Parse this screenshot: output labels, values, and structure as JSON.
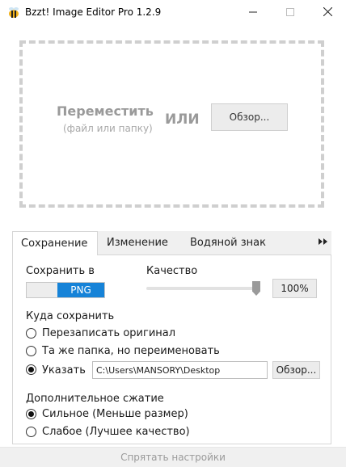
{
  "window": {
    "title": "Bzzt! Image Editor Pro 1.2.9",
    "app_icon": "bee-icon",
    "controls": [
      "minimize-icon",
      "maximize-icon",
      "close-icon"
    ]
  },
  "drop_zone": {
    "title": "Переместить",
    "subtitle": "(файл или папку)",
    "or_label": "ИЛИ",
    "browse_label": "Обзор..."
  },
  "tabs": {
    "items": [
      {
        "label": "Сохранение",
        "active": true
      },
      {
        "label": "Изменение",
        "active": false
      },
      {
        "label": "Водяной знак",
        "active": false
      }
    ],
    "more_icon": "double-chevron-right-icon"
  },
  "save_panel": {
    "save_in_label": "Сохранить в",
    "format_toggle": {
      "selected": "PNG"
    },
    "quality_label": "Качество",
    "quality_value": "100%",
    "quality_level": 1.0,
    "where_label": "Куда сохранить",
    "where_options": [
      {
        "label": "Перезаписать оригинал",
        "checked": false
      },
      {
        "label": "Та же папка, но переименовать",
        "checked": false
      },
      {
        "label": "Указать",
        "checked": true
      }
    ],
    "path_value": "C:\\Users\\MANSORY\\Desktop",
    "path_browse_label": "Обзор...",
    "compression_label": "Дополнительное сжатие",
    "compression_options": [
      {
        "label": "Сильное (Меньше размер)",
        "checked": true
      },
      {
        "label": "Слабое (Лучшее качество)",
        "checked": false
      }
    ]
  },
  "footer": {
    "hide_settings_label": "Спрятать настройки"
  },
  "colors": {
    "accent": "#1683d8",
    "dashed_border": "#cfcfcf"
  }
}
